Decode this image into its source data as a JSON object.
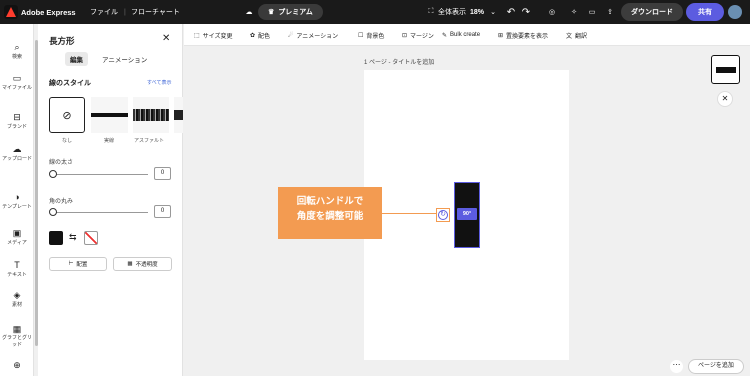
{
  "topbar": {
    "app_name": "Adobe Express",
    "file_menu": "ファイル",
    "doc_title": "フローチャート",
    "premium": "プレミアム",
    "full_view": "全体表示",
    "zoom": "18%",
    "download": "ダウンロード",
    "share": "共有"
  },
  "rail": [
    "検索",
    "マイファイル",
    "ブランド",
    "アップロード",
    "テンプレート",
    "メディア",
    "テキスト",
    "素材",
    "グラフとグリッド"
  ],
  "panel": {
    "title": "長方形",
    "tab_edit": "編集",
    "tab_anim": "アニメーション",
    "section": "線のスタイル",
    "show_all": "すべて表示",
    "styles": [
      "なし",
      "実線",
      "アスファルト"
    ],
    "stroke_width_label": "線の太さ",
    "stroke_width": "0",
    "corner_label": "角の丸み",
    "corner_value": "0",
    "align": "配置",
    "opacity": "不透明度"
  },
  "context_toolbar": [
    "サイズ変更",
    "配色",
    "アニメーション",
    "背景色",
    "マージン",
    "Bulk create",
    "置換要素を表示",
    "翻訳"
  ],
  "canvas": {
    "page_label": "1 ページ - タイトルを追加",
    "rotation": "90°",
    "add_page": "ページを追加"
  },
  "callout": {
    "line1": "回転ハンドルで",
    "line2": "角度を調整可能"
  },
  "colors": {
    "accent": "#5c5ce0",
    "callout": "#f39b51",
    "shape": "#111111"
  }
}
